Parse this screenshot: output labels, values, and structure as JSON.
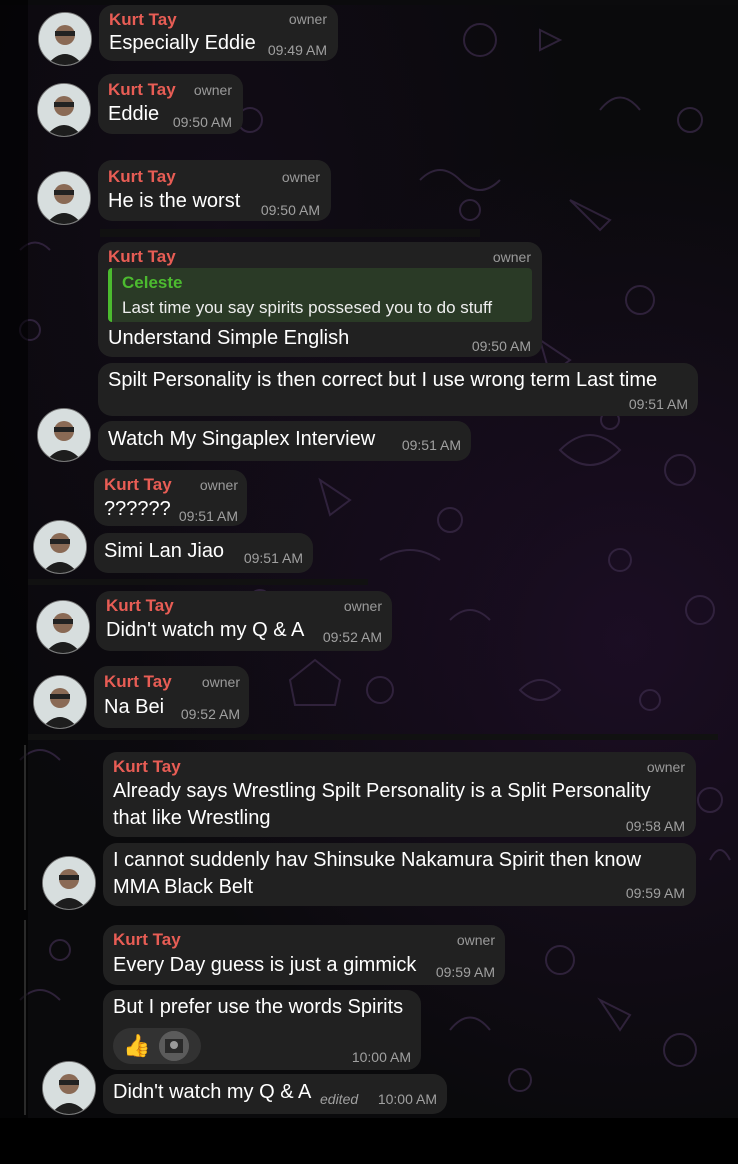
{
  "messages": [
    {
      "id": "m1",
      "sender": "Kurt Tay",
      "role": "owner",
      "text": "Especially Eddie",
      "time": "09:49 AM"
    },
    {
      "id": "m2",
      "sender": "Kurt Tay",
      "role": "owner",
      "text": "Eddie",
      "time": "09:50 AM"
    },
    {
      "id": "m3",
      "sender": "Kurt Tay",
      "role": "owner",
      "text": "He is the worst",
      "time": "09:50 AM"
    },
    {
      "id": "m4",
      "sender": "Kurt Tay",
      "role": "owner",
      "reply_to": {
        "name": "Celeste",
        "text": "Last time you say spirits possesed you to do stuff"
      },
      "text": "Understand Simple English",
      "time": "09:50 AM"
    },
    {
      "id": "m5",
      "text": "Spilt Personality is then correct but I use wrong term Last time",
      "time": "09:51 AM"
    },
    {
      "id": "m6",
      "text": "Watch My Singaplex Interview",
      "time": "09:51 AM"
    },
    {
      "id": "m7",
      "sender": "Kurt Tay",
      "role": "owner",
      "text": "??????",
      "time": "09:51 AM"
    },
    {
      "id": "m8",
      "text": "Simi Lan Jiao",
      "time": "09:51 AM"
    },
    {
      "id": "m9",
      "sender": "Kurt Tay",
      "role": "owner",
      "text": "Didn't watch my Q & A",
      "time": "09:52 AM"
    },
    {
      "id": "m10",
      "sender": "Kurt Tay",
      "role": "owner",
      "text": "Na Bei",
      "time": "09:52 AM"
    },
    {
      "id": "m11",
      "sender": "Kurt Tay",
      "role": "owner",
      "text_line1": "Already says Wrestling Spilt Personality is a Split Personality",
      "text_line2": "that like Wrestling",
      "time": "09:58 AM"
    },
    {
      "id": "m12",
      "text_line1": "I cannot suddenly hav Shinsuke Nakamura Spirit then know",
      "text_line2": "MMA Black Belt",
      "time": "09:59 AM"
    },
    {
      "id": "m13",
      "sender": "Kurt Tay",
      "role": "owner",
      "text": "Every Day guess is just a gimmick",
      "time": "09:59 AM"
    },
    {
      "id": "m14",
      "text": "But I prefer use the words Spirits",
      "time": "10:00 AM",
      "reactions": [
        {
          "icon": "thumbs-up-icon",
          "glyph": "👍"
        },
        {
          "icon": "reactor-avatar-icon"
        }
      ]
    },
    {
      "id": "m15",
      "text": "Didn't watch my Q & A",
      "edited": "edited",
      "time": "10:00 AM"
    }
  ]
}
